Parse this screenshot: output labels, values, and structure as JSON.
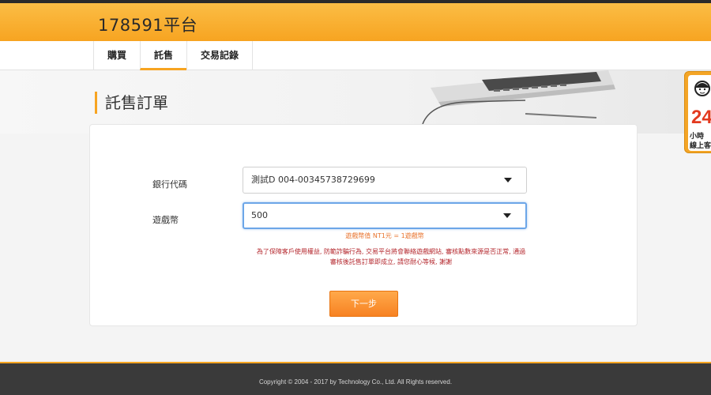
{
  "header": {
    "brand": "178591平台"
  },
  "nav": {
    "tabs": [
      {
        "label": "購買"
      },
      {
        "label": "託售"
      },
      {
        "label": "交易記錄"
      }
    ],
    "active": 1
  },
  "page": {
    "title": "託售訂單"
  },
  "form": {
    "bank_label": "銀行代碼",
    "bank_value": "測試D 004-00345738729699",
    "coin_label": "遊戲幣",
    "coin_value": "500",
    "rate_note": "遊戲幣值 NT1元 = 1遊戲幣",
    "warning_line1": "為了保障客戶使用權益, 防範詐騙行為, 交易平台將會聯絡遊戲網站, 審核點數來源是否正常, 通過",
    "warning_line2": "審核後託售訂單即成立, 請您耐心等候, 謝謝",
    "next_label": "下一步"
  },
  "side_service": {
    "number": "24",
    "line1": "小時",
    "line2": "線上客"
  },
  "footer": {
    "copyright": "Copyright © 2004 - 2017 by Technology Co., Ltd. All Rights reserved."
  },
  "colors": {
    "accent": "#f7a421",
    "warning": "#b4272d",
    "note": "#e8732d"
  }
}
